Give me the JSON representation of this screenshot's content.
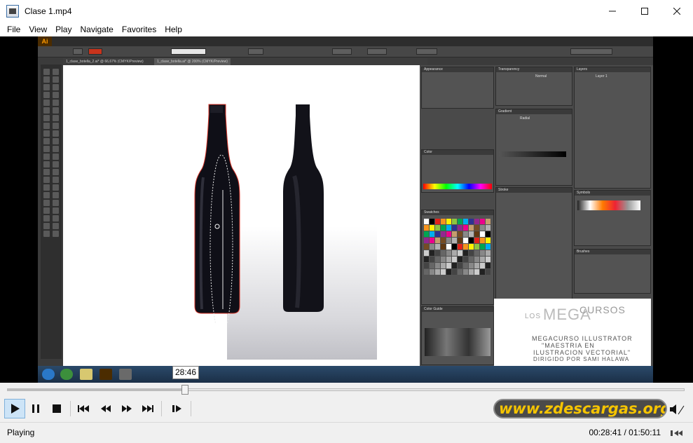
{
  "window": {
    "title": "Clase 1.mp4"
  },
  "menu": [
    "File",
    "View",
    "Play",
    "Navigate",
    "Favorites",
    "Help"
  ],
  "video": {
    "app_logo": "Ai",
    "doc_tabs": [
      "1_clase_botella_2.ai* @ 66,67% (CMYK/Preview)",
      "1_clase_botella.ai* @ 200% (CMYK/Preview)"
    ],
    "panels": [
      "Appearance",
      "Transparency",
      "Layers",
      "Color",
      "Gradient",
      "Swatches",
      "Stroke",
      "Symbols",
      "Brushes",
      "Color Guide"
    ],
    "gradient_type": "Radial",
    "blend_mode": "Normal",
    "layer_name": "Layer 1",
    "logo_text": [
      "LOS",
      "MEGA",
      "CURSOS"
    ],
    "course_lines": [
      "MEGACURSO ILLUSTRATOR",
      "\"MAESTRIA EN",
      "ILUSTRACION VECTORIAL\"",
      "DIRIGIDO POR SAMI HALAWA"
    ]
  },
  "tooltip_time": "28:46",
  "seek": {
    "progress": 0.2628
  },
  "watermark": "www.zdescargas.org",
  "status": {
    "state": "Playing",
    "time": "00:28:41 / 01:50:11"
  },
  "icons": [
    "app-icon",
    "minimize-icon",
    "maximize-icon",
    "close-icon",
    "play-icon",
    "pause-icon",
    "stop-icon",
    "skip-back-icon",
    "rewind-icon",
    "fast-forward-icon",
    "skip-forward-icon",
    "frame-step-icon",
    "volume-icon",
    "resize-grip-icon"
  ]
}
